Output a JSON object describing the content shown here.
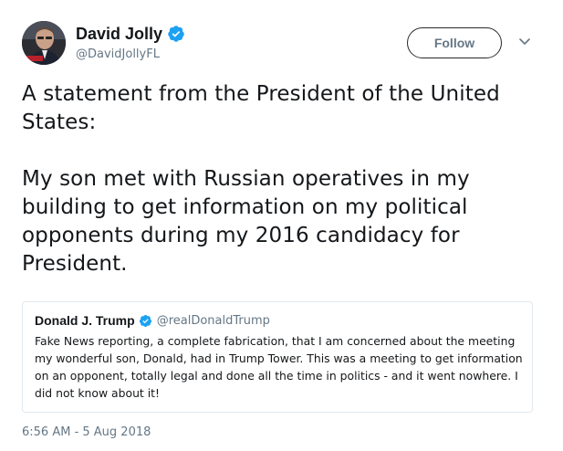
{
  "author": {
    "name": "David Jolly",
    "handle": "@DavidJollyFL",
    "verified": true
  },
  "follow_label": "Follow",
  "tweet": {
    "paragraphs": [
      "A statement from the President of the United States:",
      "My son met with Russian operatives in my building to get information on my political opponents during my 2016 candidacy for President."
    ]
  },
  "quoted_tweet": {
    "name": "Donald J. Trump",
    "handle": "@realDonaldTrump",
    "verified": true,
    "text": "Fake News reporting, a complete fabrication, that I am concerned about the meeting my wonderful son, Donald, had in Trump Tower. This was a meeting to get information on an opponent, totally legal and done all the time in politics - and it went nowhere. I did not know about it!"
  },
  "timestamp": "6:56 AM - 5 Aug 2018",
  "colors": {
    "verified_blue": "#1da1f2",
    "text_primary": "#14171a",
    "text_secondary": "#657786",
    "border": "#e1e8ed"
  },
  "icons": {
    "verified": "verified-badge-icon",
    "caret": "chevron-down-icon"
  }
}
